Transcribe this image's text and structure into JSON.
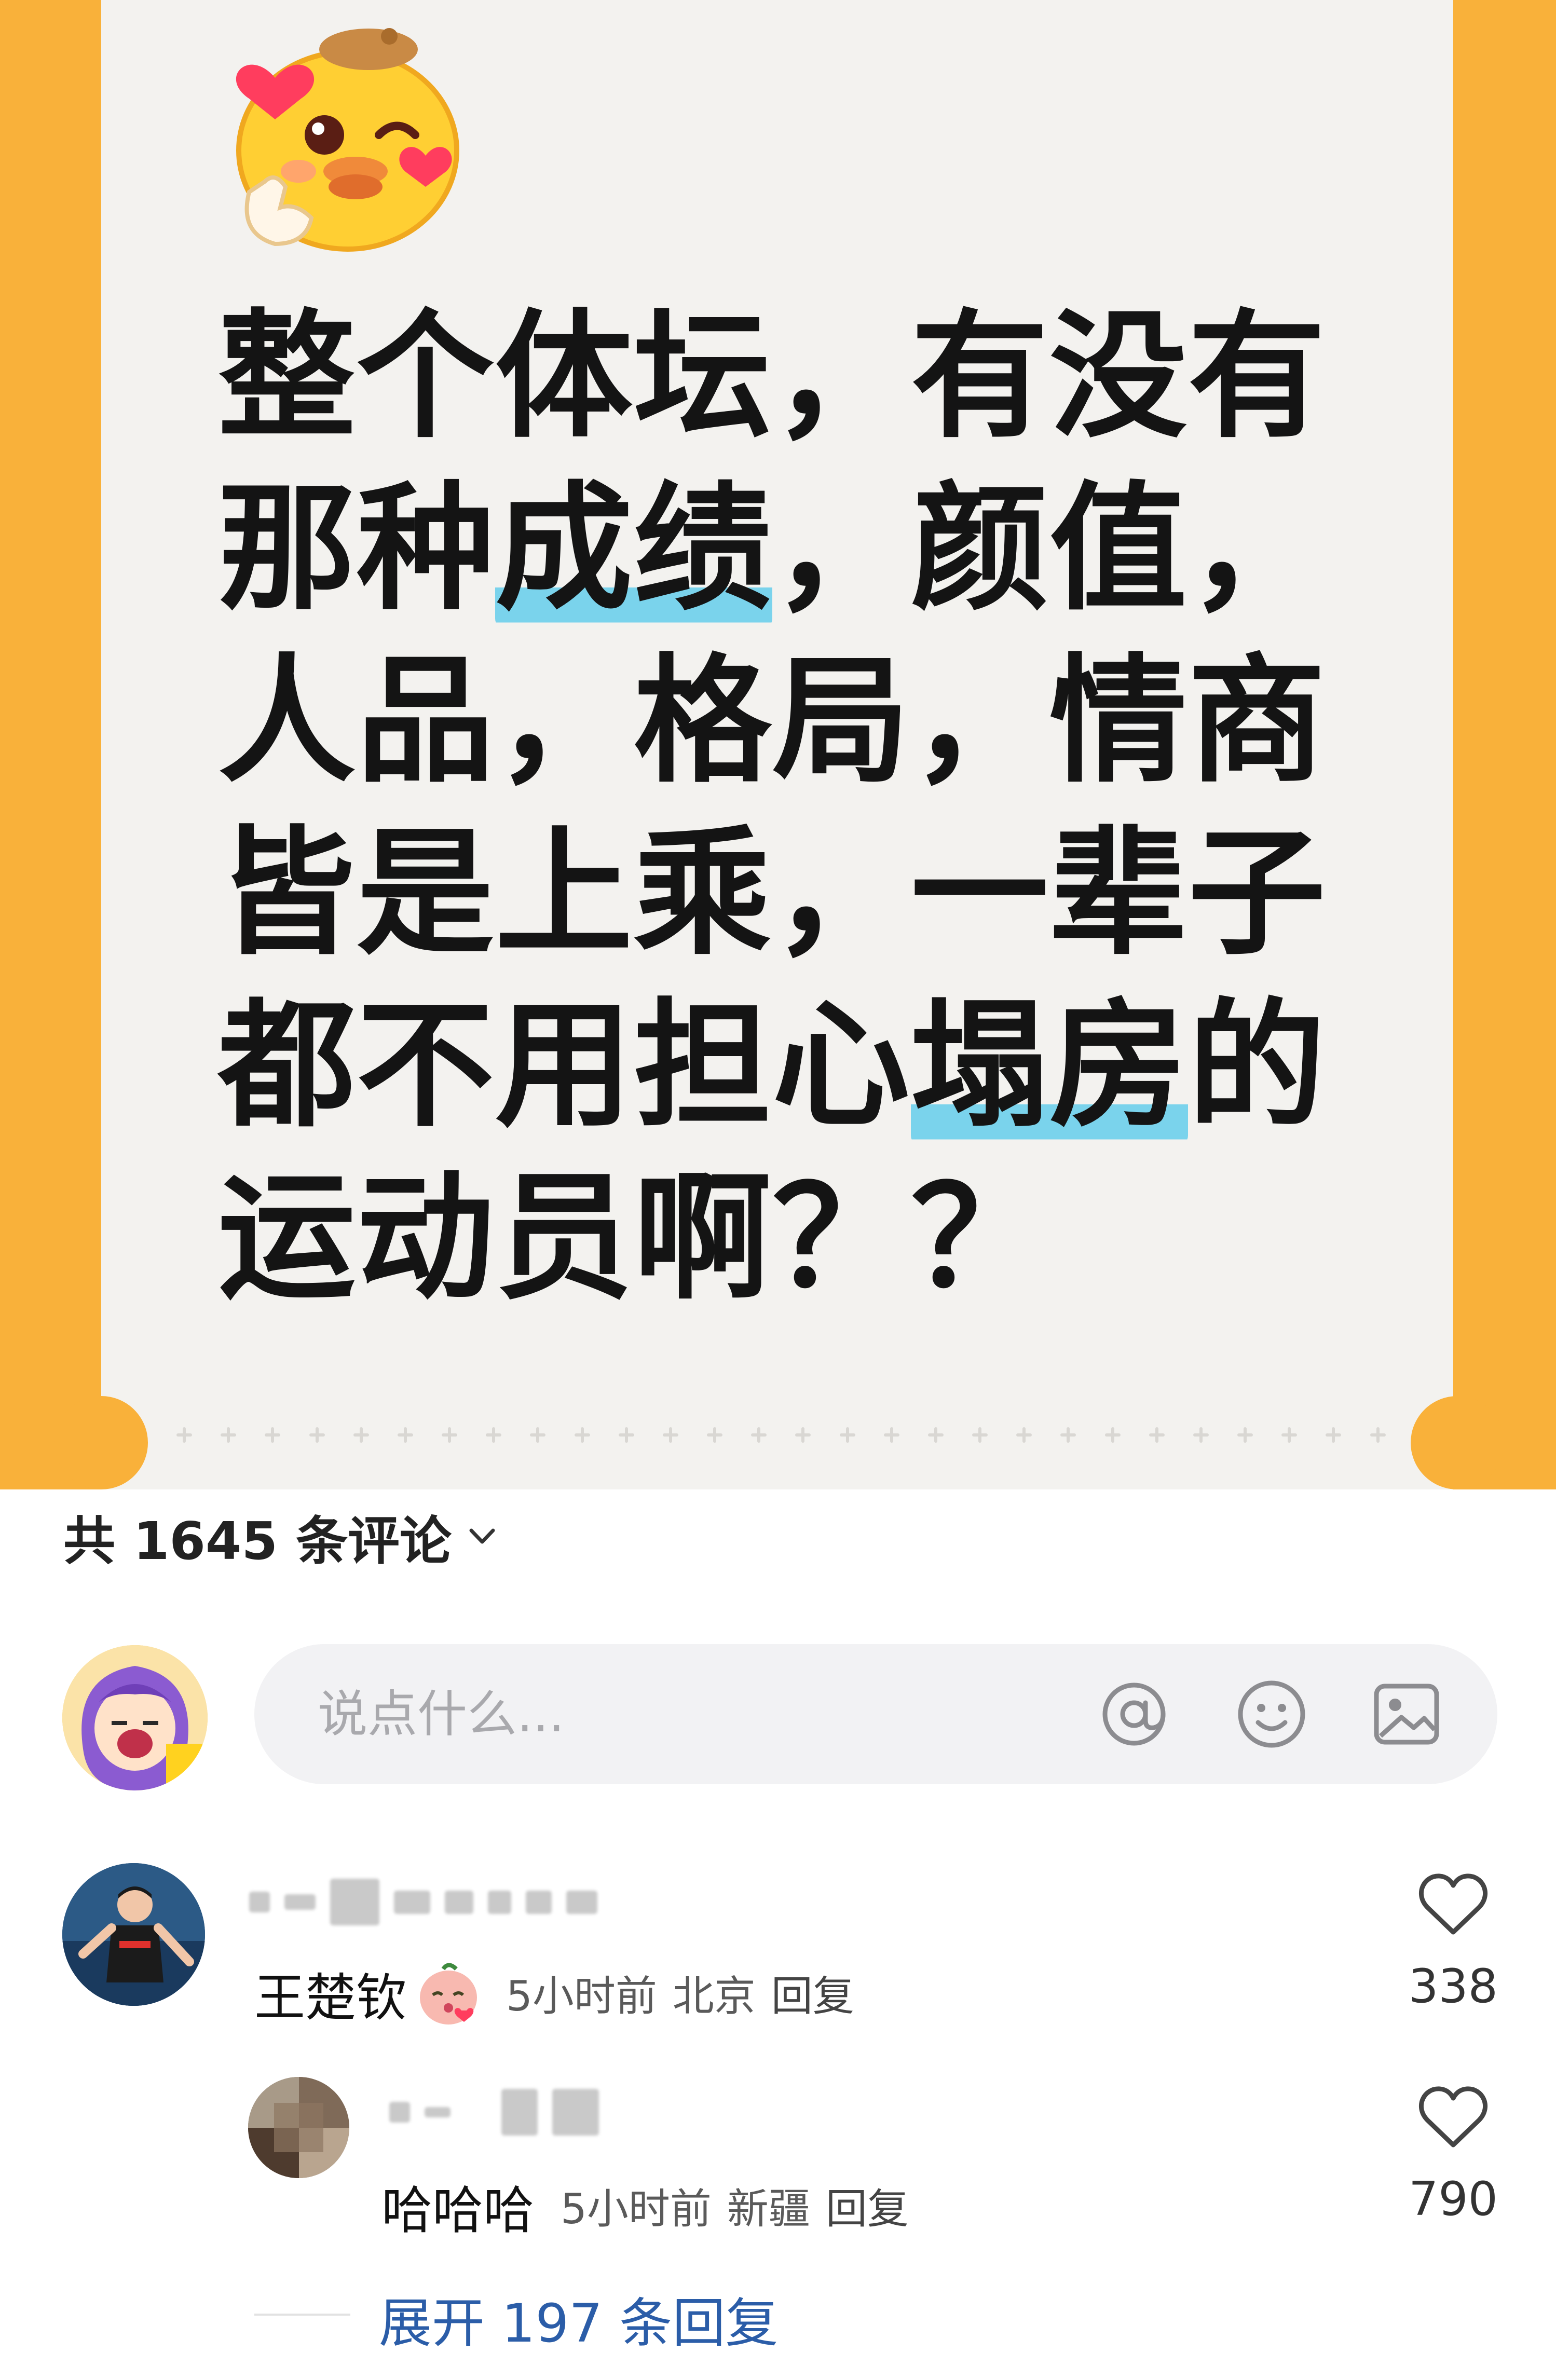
{
  "post": {
    "lines": [
      {
        "parts": [
          {
            "text": "整个体坛，有没有"
          }
        ]
      },
      {
        "parts": [
          {
            "text": "那种"
          },
          {
            "text": "成绩",
            "hl": true
          },
          {
            "text": "，颜值，"
          }
        ]
      },
      {
        "parts": [
          {
            "text": "人品，格局，情商"
          }
        ]
      },
      {
        "parts": [
          {
            "text": "皆是上乘，一辈子"
          }
        ]
      },
      {
        "parts": [
          {
            "text": "都不用担心"
          },
          {
            "text": "塌房",
            "hl": true
          },
          {
            "text": "的"
          }
        ]
      },
      {
        "parts": [
          {
            "text": "运动员啊？？"
          }
        ]
      }
    ],
    "emoji": "duck-wink-heart-emoji",
    "colors": {
      "frame": "#f9b13a",
      "paper": "#f3f2ef",
      "highlight": "#7ad3ec"
    }
  },
  "comments_header": {
    "label": "共 1645 条评论"
  },
  "composer": {
    "placeholder": "说点什么...",
    "icons": [
      "at-icon",
      "emoji-smile-icon",
      "image-icon"
    ]
  },
  "comments": [
    {
      "text": "王楚钦",
      "time": "5小时前",
      "location": "北京",
      "reply_label": "回复",
      "likes": "338"
    }
  ],
  "replies": [
    {
      "text": "哈哈哈",
      "time": "5小时前",
      "location": "新疆",
      "reply_label": "回复",
      "likes": "790"
    }
  ],
  "expand": {
    "label": "展开 197 条回复"
  },
  "accent_link_color": "#2b5da8"
}
